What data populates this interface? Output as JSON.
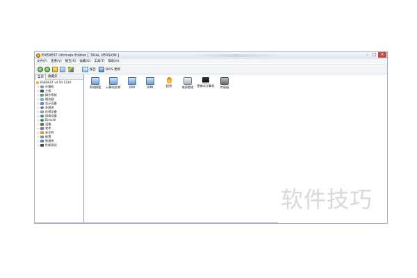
{
  "window": {
    "title": "EVEREST Ultimate Edition  [ TRIAL VERSION ]",
    "controls": {
      "minimize": "–",
      "maximize": "□",
      "close": "✕"
    }
  },
  "menubar": {
    "items": [
      "文件(F)",
      "查看(V)",
      "报告(R)",
      "收藏(O)",
      "工具(T)",
      "帮助(H)"
    ]
  },
  "toolbar": {
    "report_label": "报告",
    "bios_update_label": "BIOS 更新",
    "icons": [
      "back-icon",
      "forward-icon",
      "up-icon",
      "refresh-icon",
      "favorites-icon",
      "report-icon",
      "bios-update-icon"
    ]
  },
  "left_panel": {
    "tabs": [
      "菜单",
      "收藏夹"
    ],
    "root": "EVEREST v4.50.1330",
    "nodes": [
      "计算机",
      "主板",
      "操作系统",
      "服务器",
      "显示设备",
      "多媒体",
      "存储设备",
      "网络设备",
      "DirectX",
      "设备",
      "软件",
      "安全性",
      "配置",
      "数据库",
      "性能测试"
    ]
  },
  "content": {
    "items": [
      {
        "label": "系统摘要",
        "icon": "computer-icon"
      },
      {
        "label": "计算机名称",
        "icon": "computer-icon"
      },
      {
        "label": "DMI",
        "icon": "computer-icon"
      },
      {
        "label": "IPMI",
        "icon": "computer-icon"
      },
      {
        "label": "超频",
        "icon": "flame-icon"
      },
      {
        "label": "电源管理",
        "icon": "power-plug-icon"
      },
      {
        "label": "便携式计算机",
        "icon": "laptop-icon"
      },
      {
        "label": "传感器",
        "icon": "sensor-icon"
      }
    ]
  },
  "watermark": "软件技巧",
  "colors": {
    "titlebar": "#dfe5ee",
    "window_border": "#9fb1c6",
    "close_button": "#c94a3d",
    "watermark": "#d9d9d9"
  }
}
